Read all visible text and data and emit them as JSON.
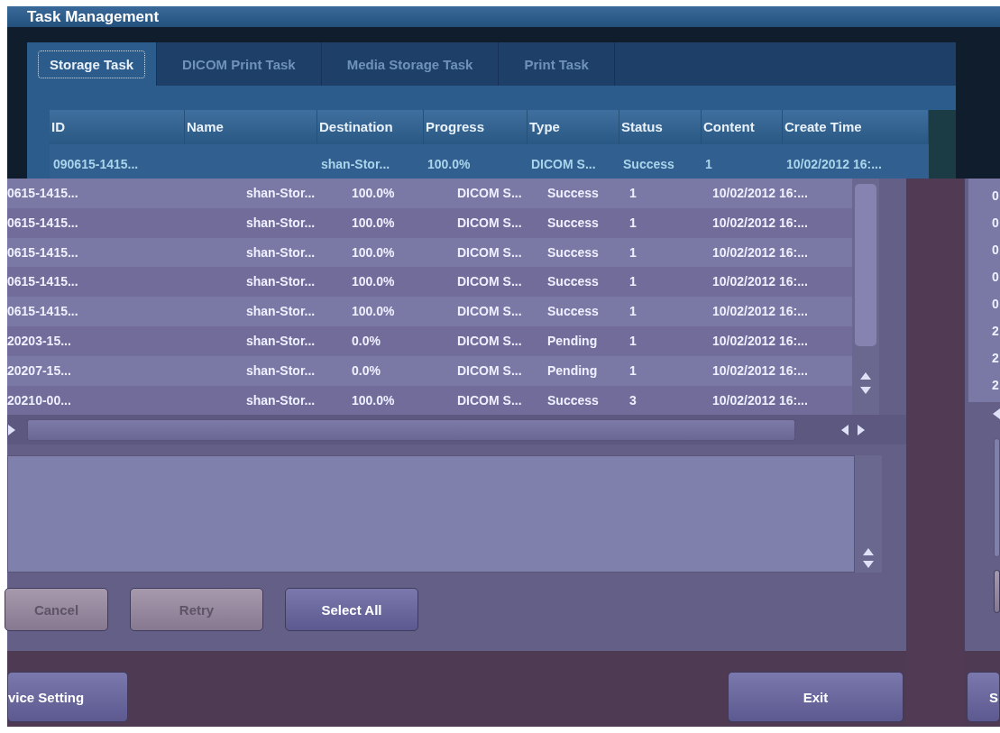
{
  "window": {
    "title": "Task Management"
  },
  "tabs": [
    {
      "label": "Storage Task",
      "selected": true
    },
    {
      "label": "DICOM Print Task",
      "selected": false
    },
    {
      "label": "Media Storage Task",
      "selected": false
    },
    {
      "label": "Print Task",
      "selected": false
    }
  ],
  "table": {
    "columns": [
      "ID",
      "Name",
      "Destination",
      "Progress",
      "Type",
      "Status",
      "Content",
      "Create Time"
    ],
    "rows": [
      {
        "id": "090615-1415...",
        "destination": "shan-Stor...",
        "progress": "100.0%",
        "type": "DICOM S...",
        "status": "Success",
        "content": "1",
        "create_time": "10/02/2012 16:..."
      }
    ]
  },
  "overlay_table": {
    "rows": [
      {
        "id": "0615-1415...",
        "destination": "shan-Stor...",
        "progress": "100.0%",
        "type": "DICOM S...",
        "status": "Success",
        "content": "1",
        "create_time": "10/02/2012 16:..."
      },
      {
        "id": "0615-1415...",
        "destination": "shan-Stor...",
        "progress": "100.0%",
        "type": "DICOM S...",
        "status": "Success",
        "content": "1",
        "create_time": "10/02/2012 16:..."
      },
      {
        "id": "0615-1415...",
        "destination": "shan-Stor...",
        "progress": "100.0%",
        "type": "DICOM S...",
        "status": "Success",
        "content": "1",
        "create_time": "10/02/2012 16:..."
      },
      {
        "id": "0615-1415...",
        "destination": "shan-Stor...",
        "progress": "100.0%",
        "type": "DICOM S...",
        "status": "Success",
        "content": "1",
        "create_time": "10/02/2012 16:..."
      },
      {
        "id": "0615-1415...",
        "destination": "shan-Stor...",
        "progress": "100.0%",
        "type": "DICOM S...",
        "status": "Success",
        "content": "1",
        "create_time": "10/02/2012 16:..."
      },
      {
        "id": "20203-15...",
        "destination": "shan-Stor...",
        "progress": "0.0%",
        "type": "DICOM S...",
        "status": "Pending",
        "content": "1",
        "create_time": "10/02/2012 16:..."
      },
      {
        "id": "20207-15...",
        "destination": "shan-Stor...",
        "progress": "0.0%",
        "type": "DICOM S...",
        "status": "Pending",
        "content": "1",
        "create_time": "10/02/2012 16:..."
      },
      {
        "id": "20210-00...",
        "destination": "shan-Stor...",
        "progress": "100.0%",
        "type": "DICOM S...",
        "status": "Success",
        "content": "3",
        "create_time": "10/02/2012 16:..."
      }
    ]
  },
  "buttons": [
    {
      "label": "Cancel",
      "disabled": true
    },
    {
      "label": "Retry",
      "disabled": true
    },
    {
      "label": "Select All",
      "disabled": false
    }
  ],
  "footer_buttons": [
    {
      "label": "vice Setting"
    },
    {
      "label": "Exit"
    }
  ],
  "side_panel": {
    "column_values": [
      "0",
      "0",
      "0",
      "0",
      "0",
      "2",
      "2",
      "2"
    ],
    "button_label": "S"
  }
}
